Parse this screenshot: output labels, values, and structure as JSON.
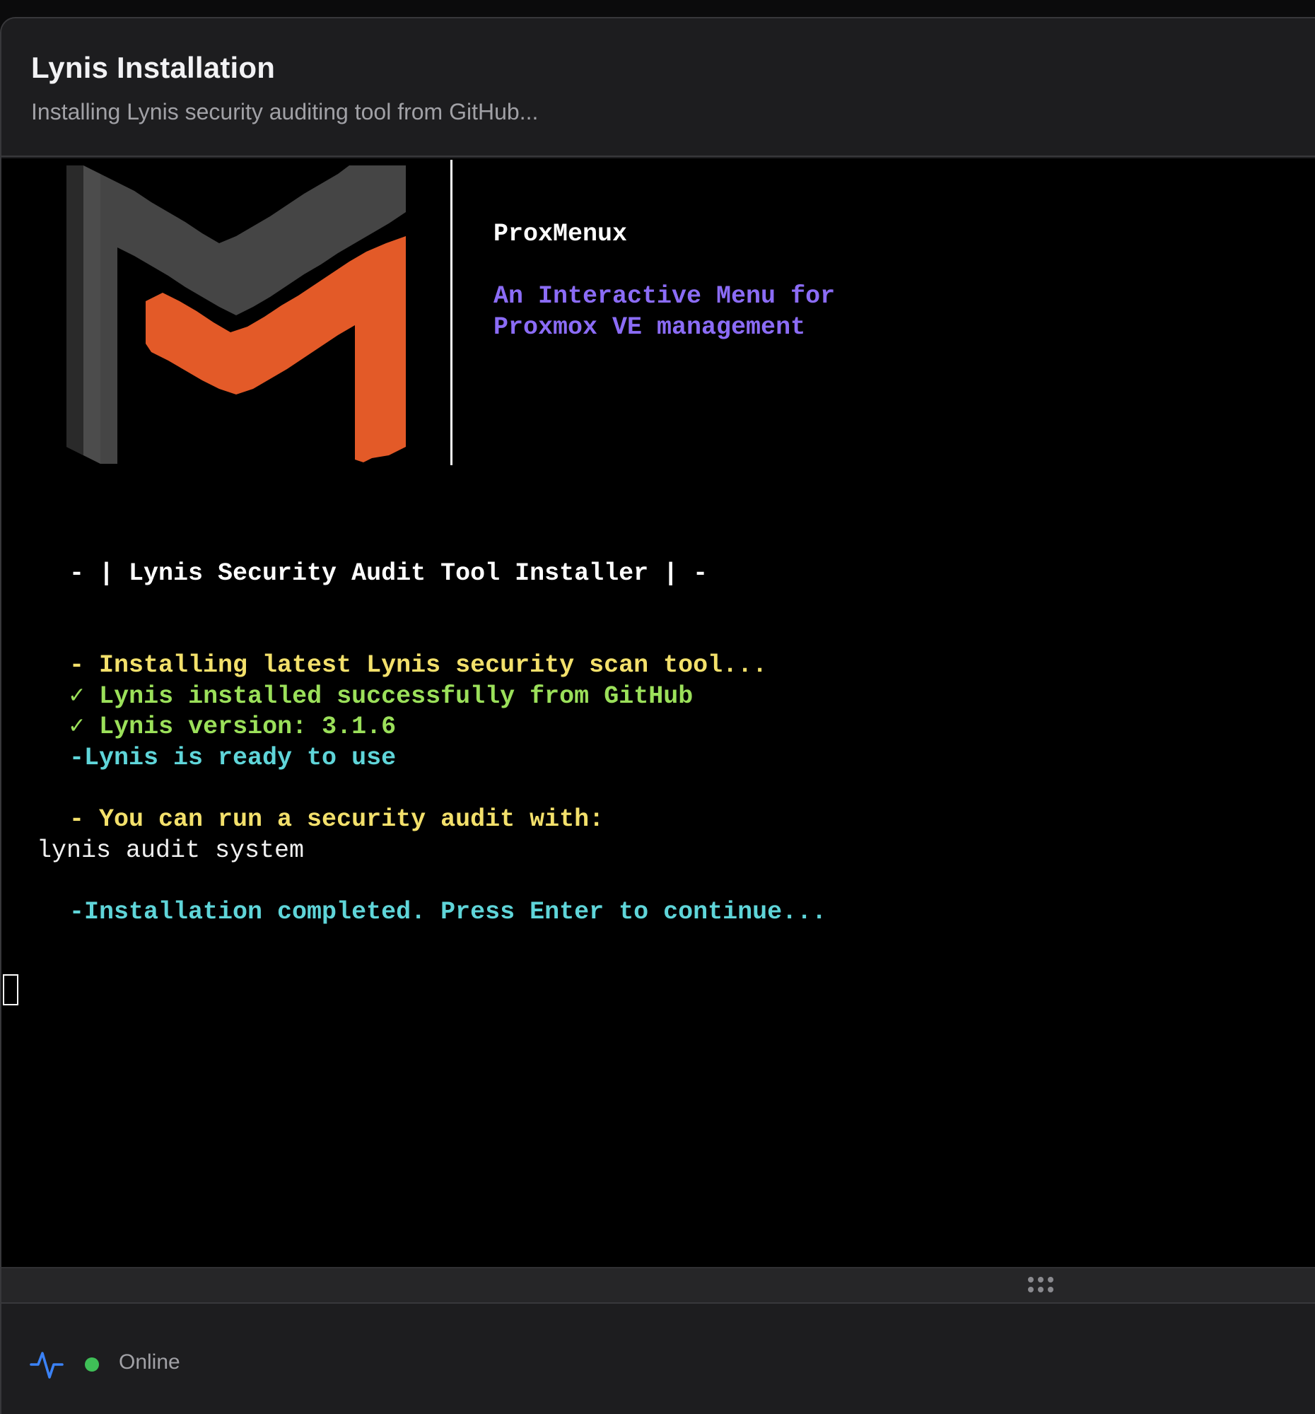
{
  "dialog": {
    "title": "Lynis Installation",
    "subtitle": "Installing Lynis security auditing tool from GitHub..."
  },
  "terminal": {
    "brand": "ProxMenux",
    "tagline": "An Interactive Menu for\nProxmox VE management",
    "lines": [
      {
        "text": "- | Lynis Security Audit Tool Installer | -",
        "color": "white"
      },
      {
        "text": "- Installing latest Lynis security scan tool...",
        "color": "yellow"
      },
      {
        "text": "✓ Lynis installed successfully from GitHub",
        "color": "green"
      },
      {
        "text": "✓ Lynis version: 3.1.6",
        "color": "green"
      },
      {
        "text": "-Lynis is ready to use",
        "color": "cyan"
      },
      {
        "text": "- You can run a security audit with:",
        "color": "yellow"
      },
      {
        "text": "lynis audit system",
        "color": "plain"
      },
      {
        "text": "-Installation completed. Press Enter to continue...",
        "color": "cyan"
      }
    ],
    "colors": {
      "background": "#000000",
      "white": "#ffffff",
      "yellow": "#f3e06b",
      "green": "#9be05a",
      "cyan": "#5fd5d9",
      "purple": "#8b6cf6",
      "logo_gray": "#454545",
      "logo_orange": "#e35a28"
    }
  },
  "footer": {
    "status_icon": "activity-pulse-icon",
    "status_text": "Online",
    "status_color": "#3fbf57"
  }
}
